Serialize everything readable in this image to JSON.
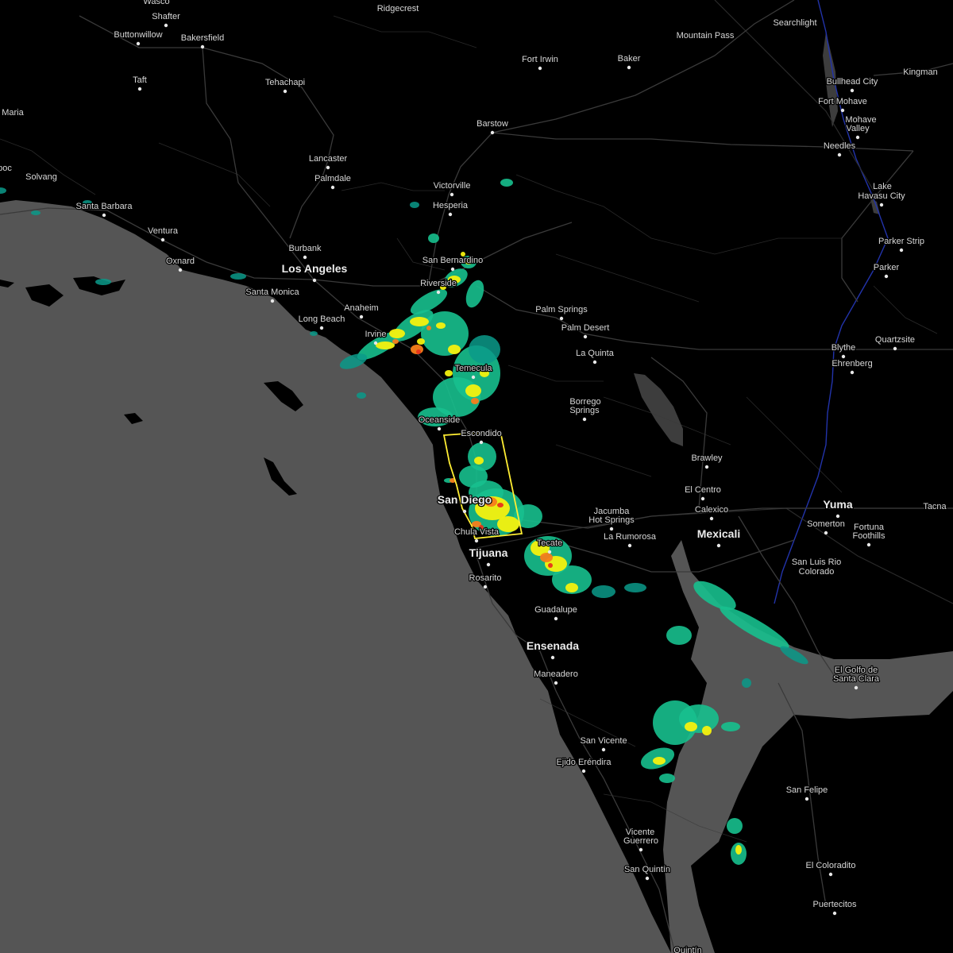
{
  "map": {
    "colors": {
      "ocean": "#555555",
      "land": "#000000",
      "roads": "#3a3a3a",
      "borders": "#2a2a2a",
      "river": "#2233aa",
      "lake": "#3d3d3d",
      "labels": "#d8d8d8",
      "warning_polygon": "#ffee33"
    },
    "radar_scale": {
      "light": "#0b9a8a",
      "moderate": "#17c08e",
      "heavy": "#f4f10e",
      "intense": "#f77d1a",
      "extreme": "#e8311a"
    },
    "cities": [
      {
        "id": "shafter",
        "name": "Shafter"
      },
      {
        "id": "wasco",
        "name": "Wasco"
      },
      {
        "id": "buttonwillow",
        "name": "Buttonwillow"
      },
      {
        "id": "bakersfield",
        "name": "Bakersfield"
      },
      {
        "id": "ridgecrest",
        "name": "Ridgecrest"
      },
      {
        "id": "mountain-pass",
        "name": "Mountain Pass"
      },
      {
        "id": "searchlight",
        "name": "Searchlight"
      },
      {
        "id": "fort-irwin",
        "name": "Fort Irwin"
      },
      {
        "id": "baker",
        "name": "Baker"
      },
      {
        "id": "taft",
        "name": "Taft"
      },
      {
        "id": "tehachapi",
        "name": "Tehachapi"
      },
      {
        "id": "bullhead-city",
        "name": "Bullhead City"
      },
      {
        "id": "kingman",
        "name": "Kingman"
      },
      {
        "id": "fort-mohave",
        "name": "Fort Mohave"
      },
      {
        "id": "mohave-valley-1",
        "name": "Mohave"
      },
      {
        "id": "mohave-valley-2",
        "name": "Valley"
      },
      {
        "id": "maria",
        "name": "Maria"
      },
      {
        "id": "barstow",
        "name": "Barstow"
      },
      {
        "id": "needles",
        "name": "Needles"
      },
      {
        "id": "lancaster",
        "name": "Lancaster"
      },
      {
        "id": "poc",
        "name": "poc"
      },
      {
        "id": "solvang",
        "name": "Solvang"
      },
      {
        "id": "palmdale",
        "name": "Palmdale"
      },
      {
        "id": "victorville",
        "name": "Victorville"
      },
      {
        "id": "lake-havasu-1",
        "name": "Lake"
      },
      {
        "id": "lake-havasu-2",
        "name": "Havasu City"
      },
      {
        "id": "santa-barbara",
        "name": "Santa Barbara"
      },
      {
        "id": "hesperia",
        "name": "Hesperia"
      },
      {
        "id": "ventura",
        "name": "Ventura"
      },
      {
        "id": "parker-strip",
        "name": "Parker Strip"
      },
      {
        "id": "burbank",
        "name": "Burbank"
      },
      {
        "id": "san-bernardino",
        "name": "San Bernardino"
      },
      {
        "id": "oxnard",
        "name": "Oxnard"
      },
      {
        "id": "los-angeles",
        "name": "Los Angeles"
      },
      {
        "id": "parker",
        "name": "Parker"
      },
      {
        "id": "riverside",
        "name": "Riverside"
      },
      {
        "id": "santa-monica",
        "name": "Santa Monica"
      },
      {
        "id": "palm-springs",
        "name": "Palm Springs"
      },
      {
        "id": "anaheim",
        "name": "Anaheim"
      },
      {
        "id": "long-beach",
        "name": "Long Beach"
      },
      {
        "id": "palm-desert",
        "name": "Palm Desert"
      },
      {
        "id": "irvine",
        "name": "Irvine"
      },
      {
        "id": "quartzsite",
        "name": "Quartzsite"
      },
      {
        "id": "blythe",
        "name": "Blythe"
      },
      {
        "id": "la-quinta",
        "name": "La Quinta"
      },
      {
        "id": "ehrenberg",
        "name": "Ehrenberg"
      },
      {
        "id": "temecula",
        "name": "Temecula"
      },
      {
        "id": "borrego-1",
        "name": "Borrego"
      },
      {
        "id": "borrego-2",
        "name": "Springs"
      },
      {
        "id": "oceanside",
        "name": "Oceanside"
      },
      {
        "id": "escondido",
        "name": "Escondido"
      },
      {
        "id": "brawley",
        "name": "Brawley"
      },
      {
        "id": "el-centro",
        "name": "El Centro"
      },
      {
        "id": "san-diego",
        "name": "San Diego"
      },
      {
        "id": "yuma",
        "name": "Yuma"
      },
      {
        "id": "calexico",
        "name": "Calexico"
      },
      {
        "id": "jacumba-1",
        "name": "Jacumba"
      },
      {
        "id": "jacumba-2",
        "name": "Hot Springs"
      },
      {
        "id": "tacna",
        "name": "Tacna"
      },
      {
        "id": "somerton",
        "name": "Somerton"
      },
      {
        "id": "fortuna-1",
        "name": "Fortuna"
      },
      {
        "id": "fortuna-2",
        "name": "Foothills"
      },
      {
        "id": "chula-vista",
        "name": "Chula Vista"
      },
      {
        "id": "mexicali",
        "name": "Mexicali"
      },
      {
        "id": "la-rumorosa",
        "name": "La Rumorosa"
      },
      {
        "id": "tecate",
        "name": "Tecate"
      },
      {
        "id": "tijuana",
        "name": "Tijuana"
      },
      {
        "id": "slrc-1",
        "name": "San Luis Rio"
      },
      {
        "id": "slrc-2",
        "name": "Colorado"
      },
      {
        "id": "rosarito",
        "name": "Rosarito"
      },
      {
        "id": "guadalupe",
        "name": "Guadalupe"
      },
      {
        "id": "ensenada",
        "name": "Ensenada"
      },
      {
        "id": "golfo-1",
        "name": "El Golfo de"
      },
      {
        "id": "golfo-2",
        "name": "Santa Clara"
      },
      {
        "id": "maneadero",
        "name": "Maneadero"
      },
      {
        "id": "san-vicente",
        "name": "San Vicente"
      },
      {
        "id": "ejido-erendira",
        "name": "Ejido Eréndira"
      },
      {
        "id": "san-felipe",
        "name": "San Felipe"
      },
      {
        "id": "vicente-guerrero-1",
        "name": "Vicente"
      },
      {
        "id": "vicente-guerrero-2",
        "name": "Guerrero"
      },
      {
        "id": "san-quintin",
        "name": "San Quintín"
      },
      {
        "id": "quintin",
        "name": "Quintín"
      },
      {
        "id": "el-coloradito",
        "name": "El Coloradito"
      },
      {
        "id": "puertecitos",
        "name": "Puertecitos"
      }
    ]
  }
}
